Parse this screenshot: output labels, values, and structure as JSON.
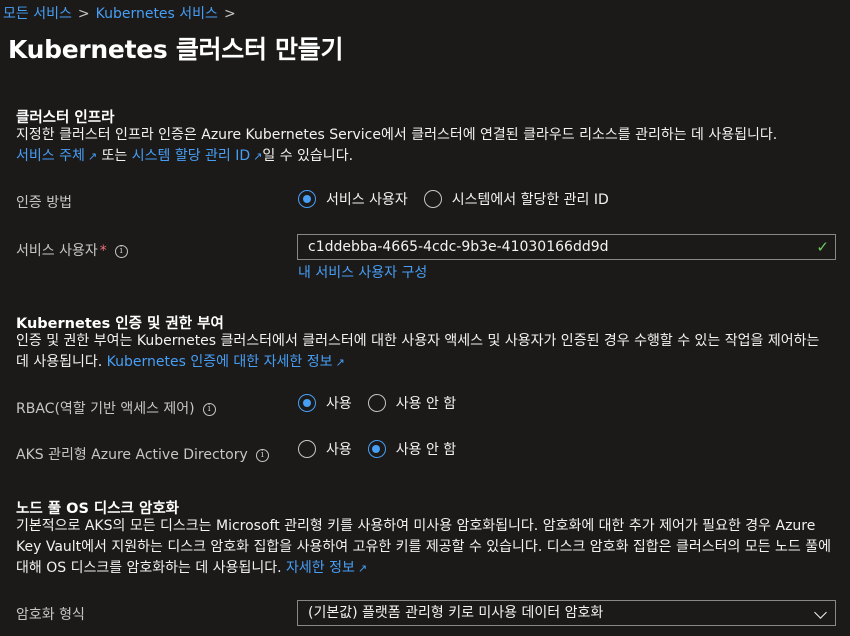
{
  "breadcrumb": {
    "item1": "모든 서비스",
    "item2": "Kubernetes 서비스",
    "sep": ">"
  },
  "title": "Kubernetes 클러스터 만들기",
  "cluster_infra": {
    "heading": "클러스터 인프라",
    "desc1": "지정한 클러스터 인프라 인증은 Azure Kubernetes Service에서 클러스터에 연결된 클라우드 리소스를 관리하는 데 사용됩니다.",
    "link_service_principal": "서비스 주체",
    "or_text": "또는",
    "link_managed_identity": "시스템 할당 관리 ID",
    "desc_end": "일 수 있습니다.",
    "auth_method_label": "인증 방법",
    "auth_options": [
      "서비스 사용자",
      "시스템에서 할당한 관리 ID"
    ],
    "sp_label": "서비스 사용자",
    "required_mark": "*",
    "sp_value": "c1ddebba-4665-4cdc-9b3e-41030166dd9d",
    "configure_link": "내 서비스 사용자 구성"
  },
  "k8s_auth": {
    "heading": "Kubernetes 인증 및 권한 부여",
    "desc": "인증 및 권한 부여는 Kubernetes 클러스터에서 클러스터에 대한 사용자 액세스 및 사용자가 인증된 경우 수행할 수 있는 작업을 제어하는 데 사용됩니다.",
    "link": "Kubernetes 인증에 대한 자세한 정보",
    "rbac_label": "RBAC(역할 기반 액세스 제어)",
    "rbac_options": [
      "사용",
      "사용 안 함"
    ],
    "aad_label": "AKS 관리형 Azure Active Directory",
    "aad_options": [
      "사용",
      "사용 안 함"
    ]
  },
  "encryption": {
    "heading": "노드 풀 OS 디스크 암호화",
    "desc": "기본적으로 AKS의 모든 디스크는 Microsoft 관리형 키를 사용하여 미사용 암호화됩니다. 암호화에 대한 추가 제어가 필요한 경우 Azure Key Vault에서 지원하는 디스크 암호화 집합을 사용하여 고유한 키를 제공할 수 있습니다. 디스크 암호화 집합은 클러스터의 모든 노드 풀에 대해 OS 디스크를 암호화하는 데 사용됩니다.",
    "link": "자세한 정보",
    "type_label": "암호화 형식",
    "type_value": "(기본값) 플랫폼 관리형 키로 미사용 데이터 암호화"
  },
  "icons": {
    "info": "i",
    "external": "↗",
    "check": "✓"
  },
  "colors": {
    "accent": "#479ef5",
    "background": "#1b1a19",
    "success": "#6ccb5f",
    "required": "#f1707b"
  }
}
